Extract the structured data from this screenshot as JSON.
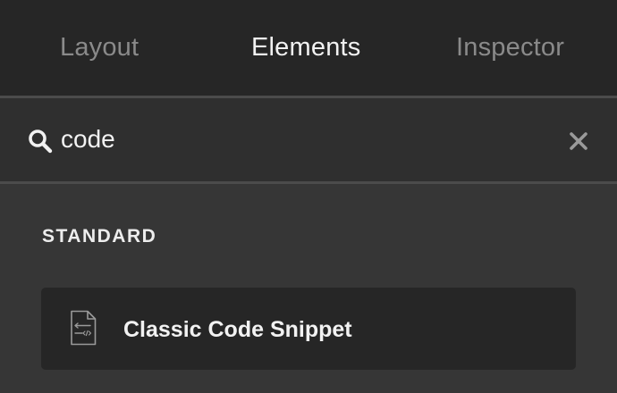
{
  "tabs": [
    {
      "label": "Layout",
      "active": false
    },
    {
      "label": "Elements",
      "active": true
    },
    {
      "label": "Inspector",
      "active": false
    }
  ],
  "search": {
    "value": "code",
    "icon": "search-icon",
    "clear_icon": "close-icon"
  },
  "sections": [
    {
      "heading": "STANDARD",
      "items": [
        {
          "label": "Classic Code Snippet",
          "icon": "code-file-icon"
        }
      ]
    }
  ],
  "colors": {
    "tabbar_bg": "#262626",
    "panel_bg": "#363636",
    "search_bg": "#2f2f2f",
    "item_bg": "#262626",
    "active_text": "#f2f2f2",
    "inactive_text": "#8a8a8a",
    "divider": "#4b4b4b"
  }
}
